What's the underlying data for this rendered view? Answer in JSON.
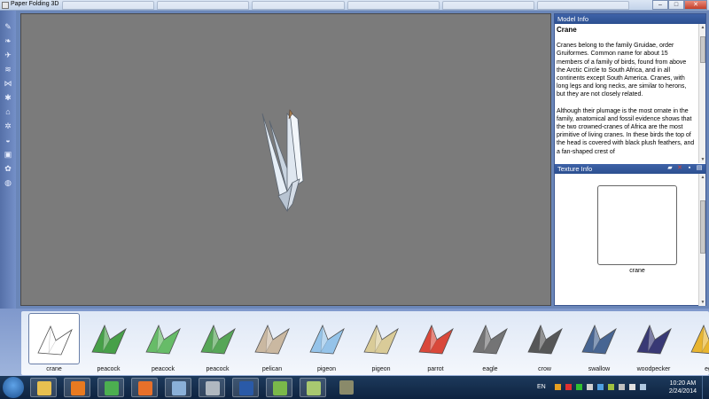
{
  "window": {
    "title": "Paper Folding 3D",
    "buttons": {
      "minimize": "–",
      "maximize": "□",
      "close": "✕"
    }
  },
  "toolbar": {
    "icons": [
      "pencil-icon",
      "bird-icon",
      "crane-icon",
      "fish-icon",
      "bow-icon",
      "dragonfly-icon",
      "hat-icon",
      "bug-icon",
      "fan-icon",
      "camera-icon",
      "flower-icon",
      "ring-icon"
    ]
  },
  "model_info": {
    "header": "Model Info",
    "name": "Crane",
    "paragraphs": [
      "Cranes belong to the family Gruidae, order Gruiformes. Common name for about 15 members of a family of birds, found from above the Arctic Circle to South Africa, and in all continents except South America. Cranes, with long legs and long necks, are similar to herons, but they are not closely related.",
      "Although their plumage is the most ornate in the family, anatomical and fossil evidence shows that the two crowned-cranes of Africa are the most primitive of living cranes. In these birds the top of the head is covered with black plush feathers, and a fan-shaped crest of"
    ]
  },
  "texture_info": {
    "header": "Texture Info",
    "label": "crane"
  },
  "models": [
    {
      "label": "crane",
      "selected": true,
      "color": "#ffffff"
    },
    {
      "label": "peacock",
      "color": "#3a9a3a"
    },
    {
      "label": "peacock",
      "color": "#5cb85c"
    },
    {
      "label": "peacock",
      "color": "#4aa04a"
    },
    {
      "label": "pelican",
      "color": "#c8b49a"
    },
    {
      "label": "pigeon",
      "color": "#8ec0e8"
    },
    {
      "label": "pigeon",
      "color": "#d8c890"
    },
    {
      "label": "parrot",
      "color": "#d83a2a"
    },
    {
      "label": "eagle",
      "color": "#6a6a6a"
    },
    {
      "label": "crow",
      "color": "#4a4a4a"
    },
    {
      "label": "swallow",
      "color": "#3a5a8a"
    },
    {
      "label": "woodpecker",
      "color": "#2a2a6a"
    },
    {
      "label": "eg",
      "color": "#e8b020"
    }
  ],
  "taskbar": {
    "lang": "EN",
    "time": "10:20 AM",
    "date": "2/24/2014",
    "apps": [
      {
        "name": "explorer",
        "color": "#e8c050"
      },
      {
        "name": "media-player",
        "color": "#e87a20"
      },
      {
        "name": "chrome",
        "color": "#4caf50"
      },
      {
        "name": "firefox",
        "color": "#e8702a"
      },
      {
        "name": "computer",
        "color": "#8ab0d8"
      },
      {
        "name": "scanner",
        "color": "#b0b8c0"
      },
      {
        "name": "word",
        "color": "#2a5aa8"
      },
      {
        "name": "frog-app",
        "color": "#7ab84a"
      },
      {
        "name": "paper-folding",
        "color": "#a8c870"
      },
      {
        "name": "tool-app",
        "color": "#8a8a6a"
      }
    ]
  }
}
